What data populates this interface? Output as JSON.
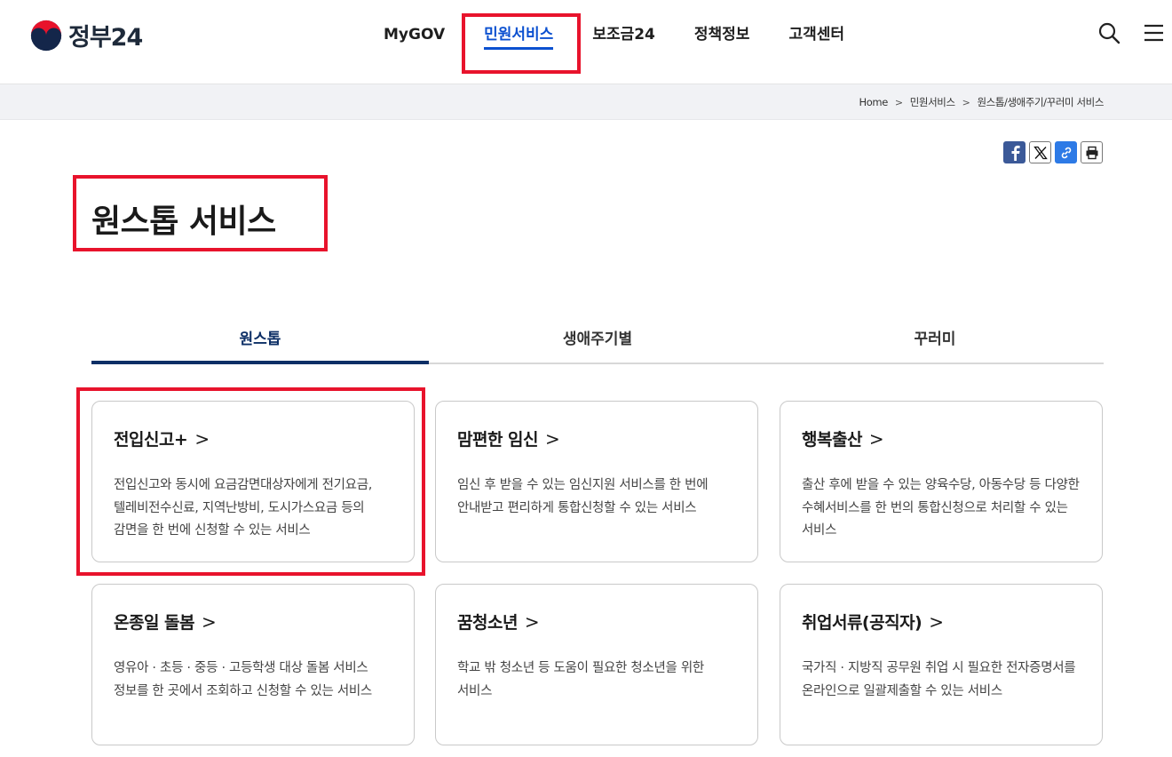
{
  "header": {
    "logo_text": "정부24",
    "nav": [
      "MyGOV",
      "민원서비스",
      "보조금24",
      "정책정보",
      "고객센터"
    ],
    "active_nav": "민원서비스"
  },
  "breadcrumb": [
    "Home",
    "민원서비스",
    "원스톱/생애주기/꾸러미 서비스"
  ],
  "page": {
    "title": "원스톱 서비스"
  },
  "tabs": [
    "원스톱",
    "생애주기별",
    "꾸러미"
  ],
  "cards": [
    {
      "title": "전입신고+",
      "desc": "전입신고와 동시에 요금감면대상자에게 전기요금, 텔레비전수신료, 지역난방비, 도시가스요금 등의 감면을 한 번에 신청할 수 있는 서비스"
    },
    {
      "title": "맘편한 임신",
      "desc": "임신 후 받을 수 있는 임신지원 서비스를 한 번에 안내받고 편리하게 통합신청할 수 있는 서비스"
    },
    {
      "title": "행복출산",
      "desc": "출산 후에 받을 수 있는 양육수당, 아동수당 등 다양한 수혜서비스를 한 번의 통합신청으로 처리할 수 있는 서비스"
    },
    {
      "title": "온종일 돌봄",
      "desc": "영유아 · 초등 · 중등 · 고등학생 대상 돌봄 서비스 정보를 한 곳에서 조회하고 신청할 수 있는 서비스"
    },
    {
      "title": "꿈청소년",
      "desc": "학교 밖 청소년 등 도움이 필요한 청소년을 위한 서비스"
    },
    {
      "title": "취업서류(공직자)",
      "desc": "국가직 · 지방직 공무원 취업 시 필요한 전자증명서를 온라인으로 일괄제출할 수 있는 서비스"
    }
  ],
  "colors": {
    "highlight": "#e8132c",
    "accent": "#0b50d0",
    "tab_active": "#0d2f66"
  }
}
